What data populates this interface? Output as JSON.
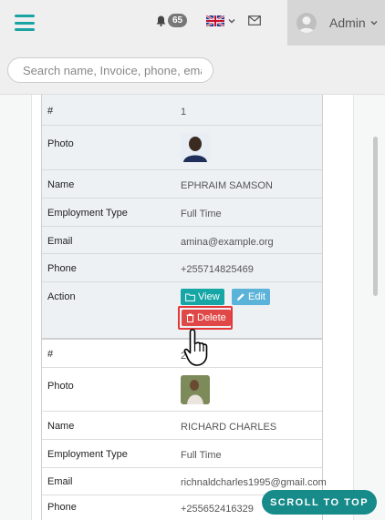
{
  "header": {
    "notification_count": "65",
    "user_name": "Admin",
    "search_placeholder": "Search name, Invoice, phone, email"
  },
  "records": [
    {
      "fields": [
        {
          "label": "#",
          "value": "1"
        },
        {
          "label": "Photo",
          "value": ""
        },
        {
          "label": "Name",
          "value": "EPHRAIM SAMSON"
        },
        {
          "label": "Employment Type",
          "value": "Full Time"
        },
        {
          "label": "Email",
          "value": "amina@example.org"
        },
        {
          "label": "Phone",
          "value": "+255714825469"
        },
        {
          "label": "Action",
          "value": ""
        }
      ],
      "actions": {
        "view": "View",
        "edit": "Edit",
        "delete": "Delete"
      }
    },
    {
      "fields": [
        {
          "label": "#",
          "value": "2"
        },
        {
          "label": "Photo",
          "value": ""
        },
        {
          "label": "Name",
          "value": "RICHARD CHARLES"
        },
        {
          "label": "Employment Type",
          "value": "Full Time"
        },
        {
          "label": "Email",
          "value": "richnaldcharles1995@gmail.com"
        },
        {
          "label": "Phone",
          "value": "+255652416329"
        }
      ]
    }
  ],
  "scroll_to_top": "SCROLL TO TOP",
  "colors": {
    "accent": "#17a6a6",
    "edit": "#5bb3d9",
    "danger": "#e04848",
    "scroll_button": "#178a8a"
  }
}
